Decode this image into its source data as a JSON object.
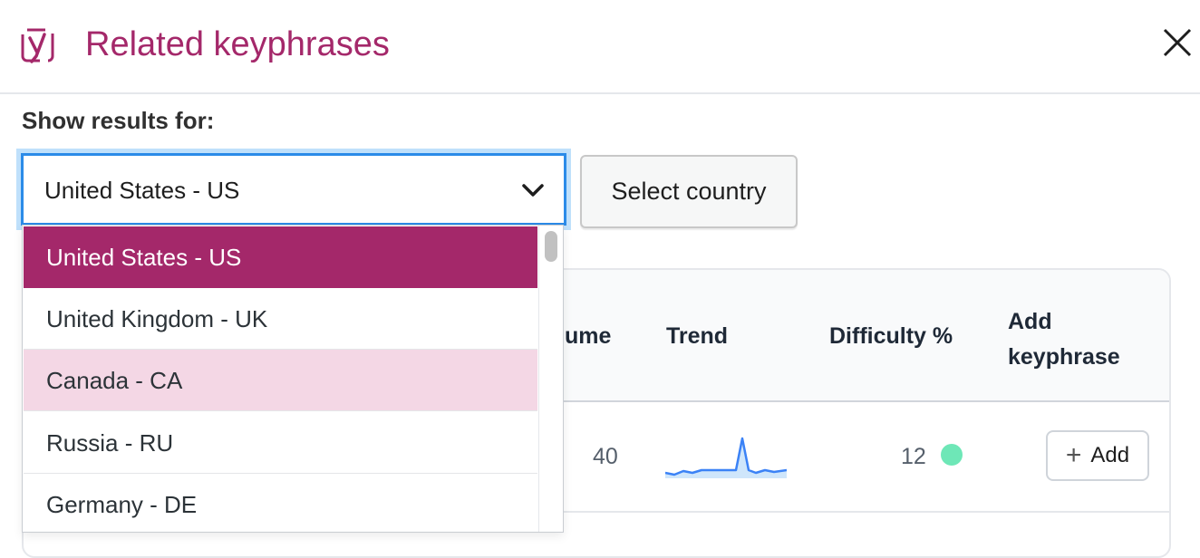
{
  "modal": {
    "title": "Related keyphrases",
    "show_label": "Show results for:",
    "select_value": "United States - US",
    "select_country_label": "Select country"
  },
  "dropdown": {
    "options": [
      {
        "label": "United States - US",
        "state": "selected"
      },
      {
        "label": "United Kingdom - UK",
        "state": "normal"
      },
      {
        "label": "Canada - CA",
        "state": "hover"
      },
      {
        "label": "Russia - RU",
        "state": "normal"
      },
      {
        "label": "Germany - DE",
        "state": "normal"
      }
    ]
  },
  "table": {
    "headers": {
      "volume": "lume",
      "trend": "Trend",
      "difficulty": "Difficulty %",
      "add_line1": "Add",
      "add_line2": "keyphrase"
    },
    "rows": [
      {
        "volume": "40",
        "difficulty": "12",
        "difficulty_color": "#6ee7b7",
        "add_label": "Add"
      }
    ]
  },
  "colors": {
    "brand": "#a4286a",
    "focus": "#2b8be8",
    "hover": "#f4d7e5"
  },
  "icons": {
    "logo": "yoast-logo-icon",
    "close": "close-icon",
    "chevron": "chevron-down-icon",
    "plus": "plus-icon"
  }
}
